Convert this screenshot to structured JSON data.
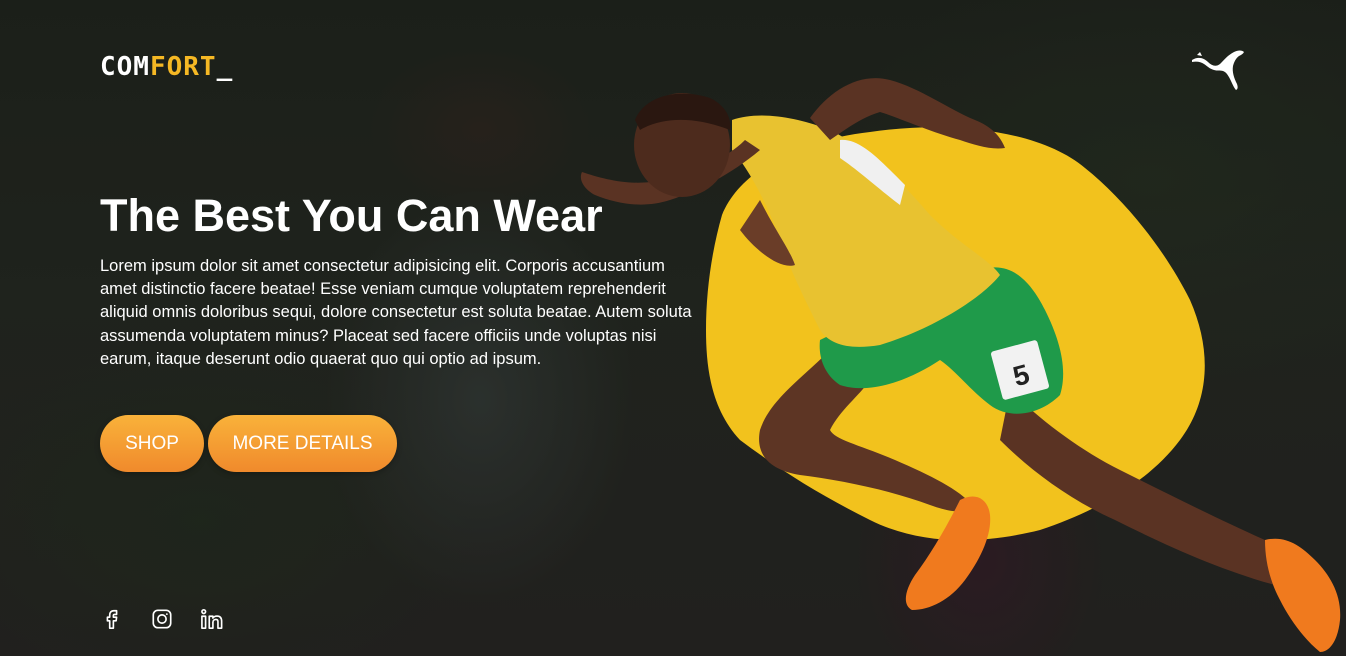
{
  "logo": {
    "part1": "COM",
    "part2": "FORT",
    "cursor": "_"
  },
  "brand_icon": "puma-logo-icon",
  "hero": {
    "title": "The Best You Can Wear",
    "description": "Lorem ipsum dolor sit amet consectetur adipisicing elit. Corporis accusantium amet distinctio facere beatae! Esse veniam cumque voluptatem reprehenderit aliquid omnis doloribus sequi, dolore consectetur est soluta beatae. Autem soluta assumenda voluptatem minus? Placeat sed facere officiis unde voluptas nisi earum, itaque deserunt odio quaerat quo qui optio ad ipsum.",
    "buttons": {
      "shop": "SHOP",
      "more": "MORE DETAILS"
    },
    "bib_number": "5"
  },
  "socials": [
    "facebook-icon",
    "instagram-icon",
    "linkedin-icon"
  ],
  "colors": {
    "accent": "#f5b824",
    "blob": "#f2c21d",
    "button_top": "#f9b23a",
    "button_bottom": "#f08a2c"
  }
}
